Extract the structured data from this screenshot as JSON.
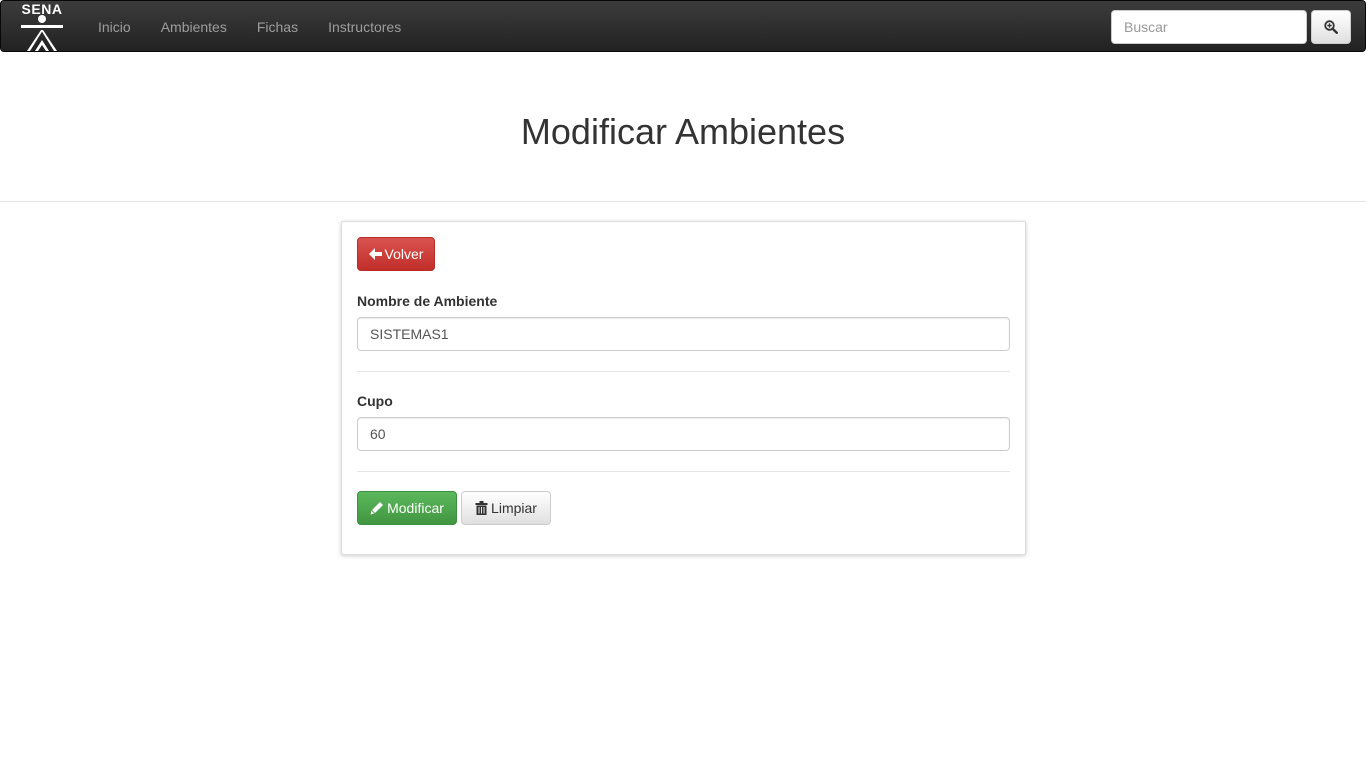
{
  "navbar": {
    "brand_text": "SENA",
    "items": [
      {
        "label": "Inicio"
      },
      {
        "label": "Ambientes"
      },
      {
        "label": "Fichas"
      },
      {
        "label": "Instructores"
      }
    ],
    "search": {
      "placeholder": "Buscar",
      "button_icon": "zoom-in-icon"
    }
  },
  "header": {
    "title": "Modificar Ambientes"
  },
  "form": {
    "back_button": {
      "label": "Volver",
      "icon": "arrow-left-icon"
    },
    "nombre": {
      "label": "Nombre de Ambiente",
      "value": "SISTEMAS1"
    },
    "cupo": {
      "label": "Cupo",
      "value": "60"
    },
    "submit_button": {
      "label": "Modificar",
      "icon": "pencil-icon"
    },
    "reset_button": {
      "label": "Limpiar",
      "icon": "trash-icon"
    }
  },
  "colors": {
    "navbar": "#222222",
    "danger": "#d9534f",
    "success": "#5cb85c"
  }
}
